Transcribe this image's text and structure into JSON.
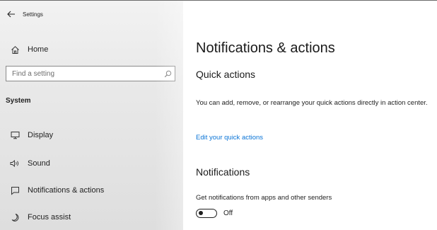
{
  "window": {
    "title": "Settings"
  },
  "sidebar": {
    "home_label": "Home",
    "search": {
      "placeholder": "Find a setting",
      "value": ""
    },
    "section_label": "System",
    "items": [
      {
        "label": "Display",
        "icon": "monitor-icon"
      },
      {
        "label": "Sound",
        "icon": "speaker-icon"
      },
      {
        "label": "Notifications & actions",
        "icon": "message-icon"
      },
      {
        "label": "Focus assist",
        "icon": "moon-icon"
      }
    ]
  },
  "main": {
    "title": "Notifications & actions",
    "quick_actions": {
      "heading": "Quick actions",
      "description": "You can add, remove, or rearrange your quick actions directly in action center.",
      "link": "Edit your quick actions"
    },
    "notifications": {
      "heading": "Notifications",
      "setting_label": "Get notifications from apps and other senders",
      "toggle_state": "Off",
      "toggle_on": false
    }
  },
  "colors": {
    "link": "#0a74d6",
    "sidebar_bg": "#e9e9e9",
    "content_bg": "#ffffff"
  }
}
